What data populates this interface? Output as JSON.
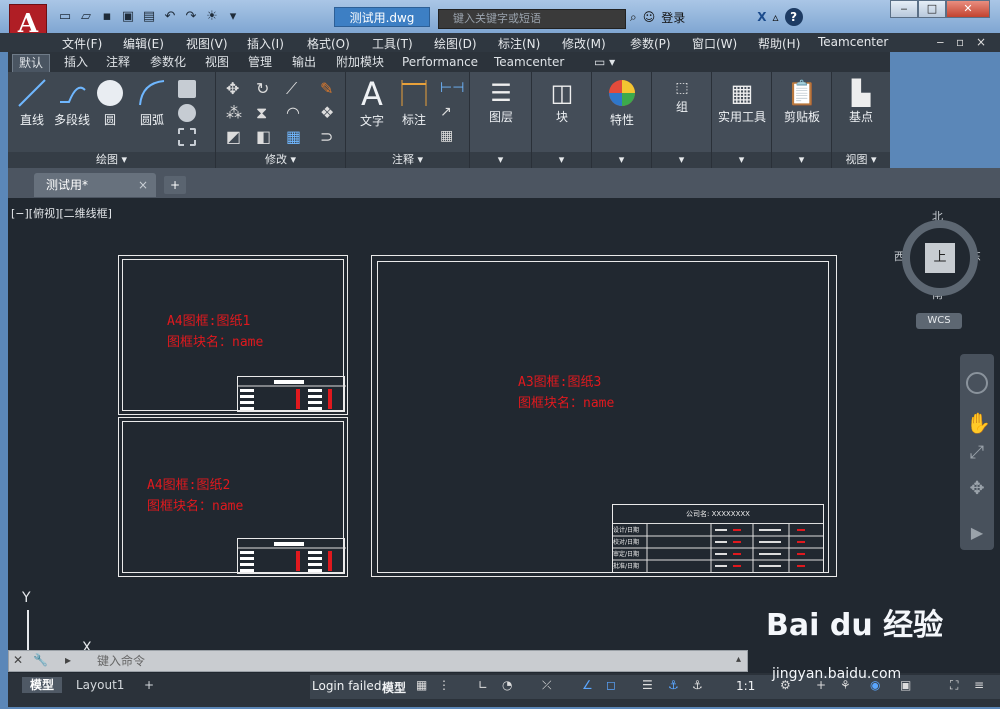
{
  "app": {
    "logo": "A",
    "doc_title": "测试用.dwg",
    "search_placeholder": "键入关键字或短语",
    "login": "登录",
    "help": "?"
  },
  "menu": [
    "文件(F)",
    "编辑(E)",
    "视图(V)",
    "插入(I)",
    "格式(O)",
    "工具(T)",
    "绘图(D)",
    "标注(N)",
    "修改(M)",
    "参数(P)",
    "窗口(W)",
    "帮助(H)",
    "Teamcenter"
  ],
  "ribbon_tabs": [
    "默认",
    "插入",
    "注释",
    "参数化",
    "视图",
    "管理",
    "输出",
    "附加模块",
    "Performance",
    "Teamcenter"
  ],
  "ribbon": {
    "draw": {
      "title": "绘图 ▾",
      "line": "直线",
      "polyline": "多段线",
      "circle": "圆",
      "arc": "圆弧"
    },
    "modify": {
      "title": "修改 ▾"
    },
    "annot": {
      "title": "注释 ▾",
      "text": "文字",
      "dim": "标注"
    },
    "layers": "图层",
    "block": "块",
    "props": "特性",
    "group": "组",
    "utils": "实用工具",
    "clip": "剪贴板",
    "view": {
      "base": "基点",
      "title": "视图 ▾"
    }
  },
  "doc_tab": {
    "label": "测试用*",
    "close": "×",
    "plus": "+"
  },
  "viewport": {
    "label": "[−][俯视][二维线框]",
    "frame1": {
      "line1": "A4图框:图纸1",
      "line2": "图框块名：name"
    },
    "frame2": {
      "line1": "A4图框:图纸2",
      "line2": "图框块名：name"
    },
    "frame3": {
      "line1": "A3图框:图纸3",
      "line2": "图框块名：name"
    },
    "a3_company": "公司名: XXXXXXXX",
    "a3_rows": [
      "设计/日期",
      "校对/日期",
      "审定/日期",
      "批准/日期"
    ],
    "compass": {
      "n": "北",
      "s": "南",
      "e": "东",
      "w": "西",
      "top": "上"
    },
    "wcs": "WCS",
    "ucs_y": "Y",
    "ucs_x": "X"
  },
  "command": {
    "placeholder": "键入命令"
  },
  "layout_tabs": [
    "模型",
    "Layout1",
    "+"
  ],
  "status": {
    "login_failed": "Login failed.",
    "model": "模型",
    "scale": "1:1"
  },
  "watermark": {
    "brand": "Bai du 经验",
    "url": "jingyan.baidu.com"
  }
}
